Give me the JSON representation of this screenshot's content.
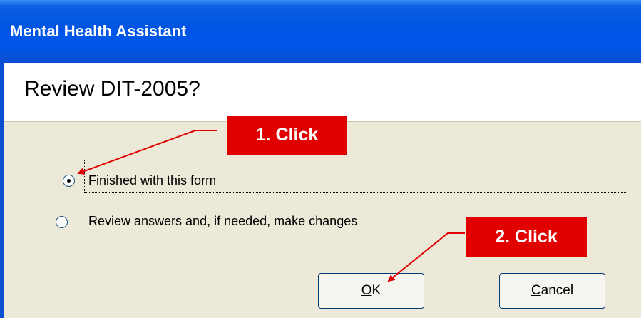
{
  "window": {
    "title": "Mental Health Assistant"
  },
  "dialog": {
    "heading": "Review DIT-2005?",
    "options": [
      {
        "label": "Finished with this form",
        "selected": true
      },
      {
        "label": "Review answers and, if needed, make changes",
        "selected": false
      }
    ],
    "buttons": {
      "ok": {
        "accel": "O",
        "rest": "K"
      },
      "cancel": {
        "accel": "C",
        "rest": "ancel"
      }
    }
  },
  "annotations": {
    "step1": "1. Click",
    "step2": "2. Click",
    "color": "#E00000"
  },
  "colors": {
    "titlebar": "#0054E3",
    "dialog_bg": "#ECE9D8"
  }
}
